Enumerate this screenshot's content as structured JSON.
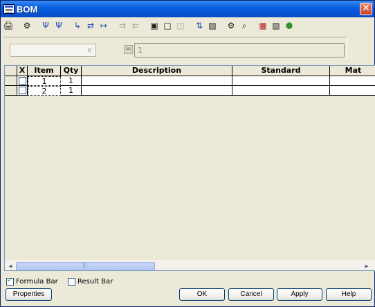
{
  "window": {
    "title": "BOM",
    "close_label": "✕"
  },
  "toolbar": {
    "icons": [
      {
        "name": "print-icon",
        "glyph": "🖨",
        "state": "normal"
      },
      {
        "name": "settings-icon",
        "glyph": "⚙",
        "state": "normal"
      },
      {
        "name": "tree-icon",
        "glyph": "Ψ",
        "state": "blue"
      },
      {
        "name": "tree-expand-icon",
        "glyph": "Ψ",
        "state": "blue"
      },
      {
        "name": "indent-icon",
        "glyph": "↳",
        "state": "blue"
      },
      {
        "name": "indent-both-icon",
        "glyph": "⇄",
        "state": "blue"
      },
      {
        "name": "outdent-icon",
        "glyph": "↦",
        "state": "blue"
      },
      {
        "name": "merge-icon",
        "glyph": "⇉",
        "state": "disabled"
      },
      {
        "name": "split-icon",
        "glyph": "⇇",
        "state": "disabled"
      },
      {
        "name": "export-icon",
        "glyph": "▣",
        "state": "normal"
      },
      {
        "name": "view-icon",
        "glyph": "□",
        "state": "normal"
      },
      {
        "name": "columns-icon",
        "glyph": "◫",
        "state": "disabled"
      },
      {
        "name": "sort-icon",
        "glyph": "⇅",
        "state": "blue"
      },
      {
        "name": "filter-icon",
        "glyph": "▨",
        "state": "normal"
      },
      {
        "name": "tools-icon",
        "glyph": "⚙",
        "state": "normal"
      },
      {
        "name": "find-icon",
        "glyph": "⌕",
        "state": "normal"
      },
      {
        "name": "part-icon",
        "glyph": "▦",
        "state": "red"
      },
      {
        "name": "save-icon",
        "glyph": "▧",
        "state": "normal"
      },
      {
        "name": "shield-icon",
        "glyph": "⬢",
        "state": "green"
      }
    ]
  },
  "formula": {
    "combo_value": "",
    "equals_label": "=",
    "input_value": "1"
  },
  "grid": {
    "columns": [
      "",
      "X",
      "Item",
      "Qty",
      "Description",
      "Standard",
      "Mat"
    ],
    "rows": [
      {
        "item": "1",
        "qty": "1",
        "description": "",
        "standard": "",
        "mat": ""
      },
      {
        "item": "2",
        "qty": "1",
        "description": "",
        "standard": "",
        "mat": ""
      }
    ]
  },
  "scrollbar": {
    "left_arrow": "◂",
    "right_arrow": "▸",
    "grip": "|||"
  },
  "options": {
    "formula_bar": {
      "label": "Formula Bar",
      "checked": true
    },
    "result_bar": {
      "label": "Result Bar",
      "checked": false
    }
  },
  "buttons": {
    "properties": "Properties",
    "ok": "OK",
    "cancel": "Cancel",
    "apply": "Apply",
    "help": "Help"
  }
}
